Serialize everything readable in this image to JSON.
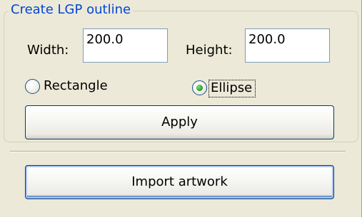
{
  "group": {
    "title": "Create LGP outline"
  },
  "width": {
    "label": "Width:",
    "value": "200.0"
  },
  "height": {
    "label": "Height:",
    "value": "200.0"
  },
  "shape": {
    "options": [
      {
        "label": "Rectangle",
        "selected": false
      },
      {
        "label": "Ellipse",
        "selected": true
      }
    ]
  },
  "buttons": {
    "apply": "Apply",
    "import": "Import artwork"
  },
  "colors": {
    "group_title": "#0046d5",
    "background": "#ece9d8",
    "radio_selected": "#2fa52c",
    "button_border": "#003c74"
  }
}
